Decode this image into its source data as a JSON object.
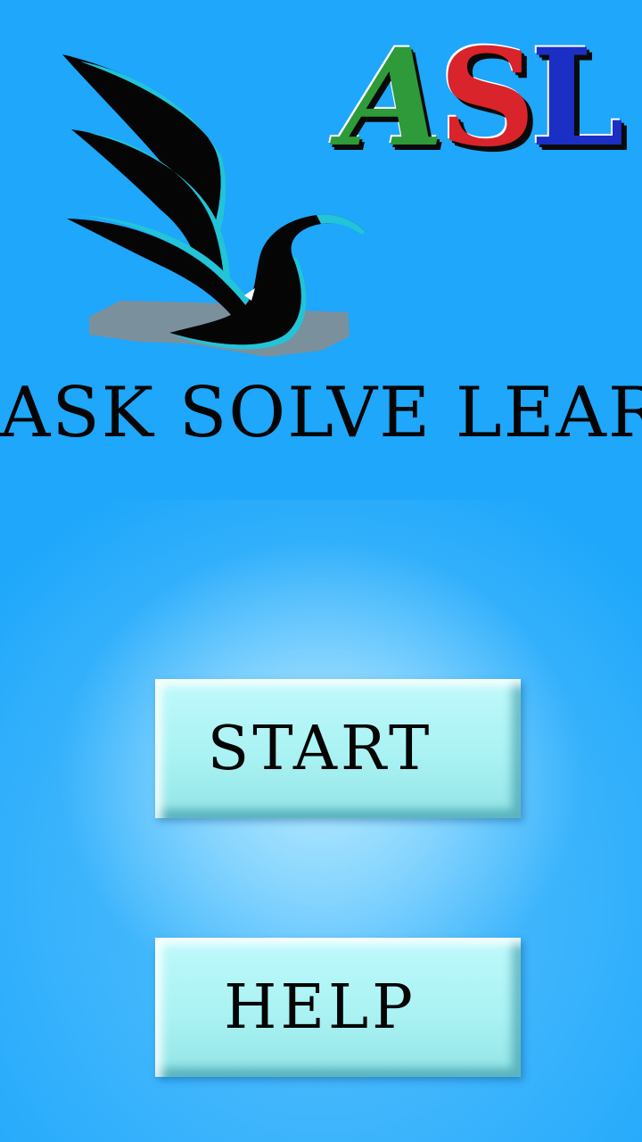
{
  "asl_logo": {
    "letters": [
      "A",
      "S",
      "L"
    ],
    "colors": [
      "#2e9a3a",
      "#d8242a",
      "#1c2fc4"
    ]
  },
  "bird_logo": {
    "icon": "bird-icon",
    "colors": {
      "body": "#050505",
      "accent": "#22c4d8",
      "shadow": "#8c8c8c"
    }
  },
  "brand_title": "ASK SOLVE LEARN",
  "menu": {
    "start_label": "START",
    "help_label": "HELP"
  },
  "theme": {
    "background": "#1ea7fb",
    "button_face": "#aaf2f3"
  }
}
